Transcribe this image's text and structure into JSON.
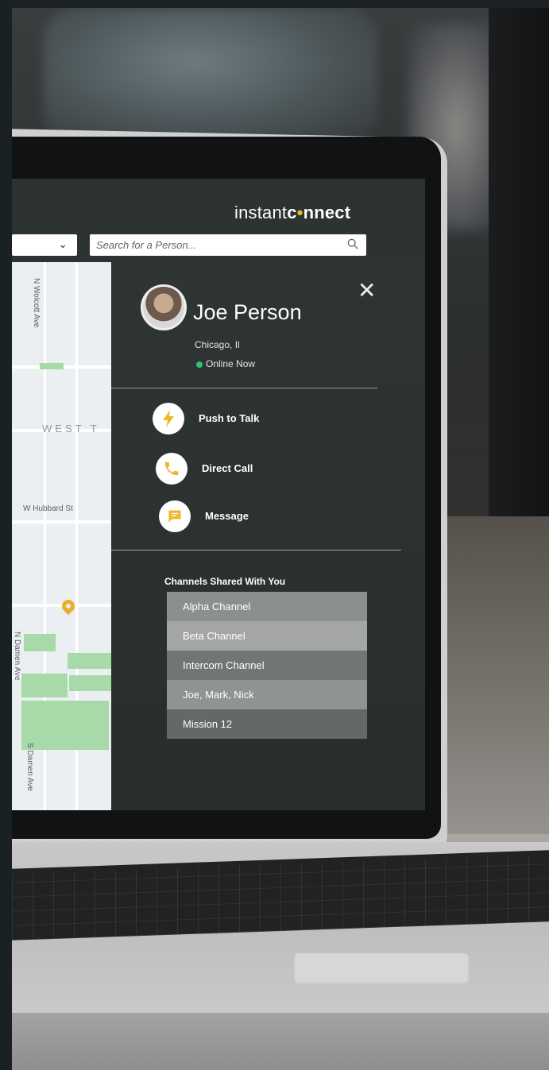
{
  "app": {
    "logo_prefix": "instant",
    "logo_c": "c",
    "logo_dot": "•",
    "logo_suffix": "nnect"
  },
  "search": {
    "placeholder": "Search for a Person..."
  },
  "map": {
    "labels": [
      "N Wolcott Ave",
      "WEST T",
      "W Hubbard St",
      "N Damen Ave",
      "S Damen Ave"
    ]
  },
  "profile": {
    "name": "Joe Person",
    "location": "Chicago, Il",
    "status": "Online Now",
    "status_color": "#34c07a"
  },
  "actions": [
    {
      "label": "Push to Talk",
      "icon": "lightning-icon"
    },
    {
      "label": "Direct Call",
      "icon": "phone-icon"
    },
    {
      "label": "Message",
      "icon": "message-icon"
    }
  ],
  "channels": {
    "title": "Channels Shared With You",
    "items": [
      "Alpha Channel",
      "Beta Channel",
      "Intercom Channel",
      "Joe, Mark, Nick",
      "Mission 12"
    ]
  },
  "colors": {
    "accent": "#f0b72b",
    "map_park": "#a8d9a8"
  }
}
